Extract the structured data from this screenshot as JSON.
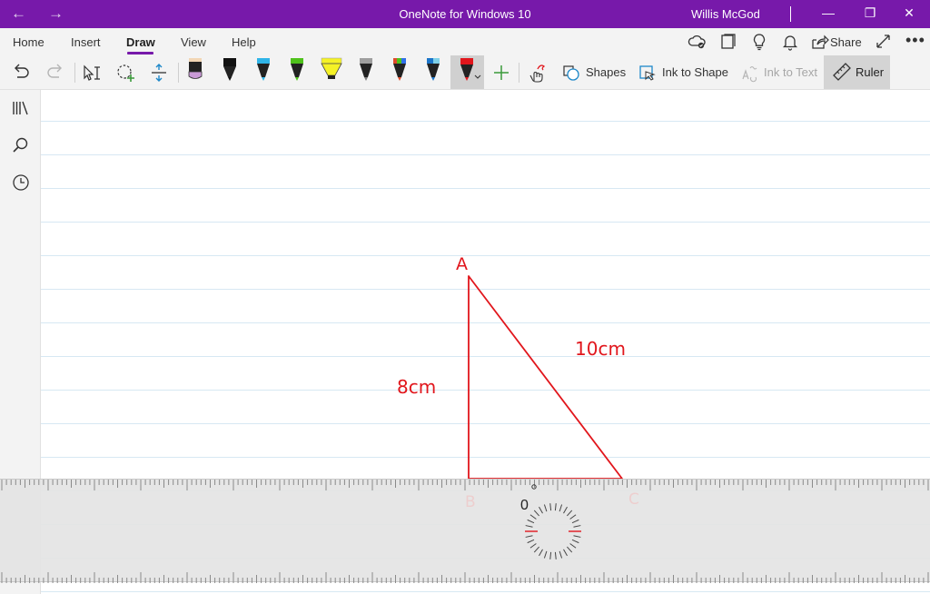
{
  "titlebar": {
    "back": "←",
    "forward": "→",
    "title": "OneNote for Windows 10",
    "user": "Willis McGod",
    "minimize": "—",
    "restore": "❐",
    "close": "✕"
  },
  "tabs": [
    {
      "label": "Home"
    },
    {
      "label": "Insert"
    },
    {
      "label": "Draw"
    },
    {
      "label": "View"
    },
    {
      "label": "Help"
    }
  ],
  "active_tab": "Draw",
  "ribbon_right": {
    "share_label": "Share",
    "more": "•••"
  },
  "toolbar": {
    "shapes_label": "Shapes",
    "ink_to_shape_label": "Ink to Shape",
    "ink_to_text_label": "Ink to Text",
    "ruler_label": "Ruler"
  },
  "pens": [
    {
      "name": "pen-purple",
      "color": "#c99ad6"
    },
    {
      "name": "pen-black",
      "color": "#111111"
    },
    {
      "name": "pen-cyan",
      "color": "#2fb4e8"
    },
    {
      "name": "pen-green",
      "color": "#4fc21b"
    },
    {
      "name": "highlighter-yellow",
      "color": "#f5f226"
    },
    {
      "name": "pen-galaxy",
      "color": "#9e9e9e"
    },
    {
      "name": "pen-rainbow",
      "color": "#e04b2b"
    },
    {
      "name": "pen-ocean",
      "color": "#1b75c9"
    },
    {
      "name": "pen-red-selected",
      "color": "#e1161c"
    }
  ],
  "drawing": {
    "ink_color": "#e1161c",
    "label_a": "A",
    "label_side_left": "8cm",
    "label_side_hyp": "10cm",
    "label_b": "B",
    "label_c": "C"
  },
  "ruler": {
    "angle_readout": "0"
  },
  "colors": {
    "accent": "#7719aa",
    "ink_red": "#e1161c",
    "line_blue": "#d7e8f3"
  }
}
